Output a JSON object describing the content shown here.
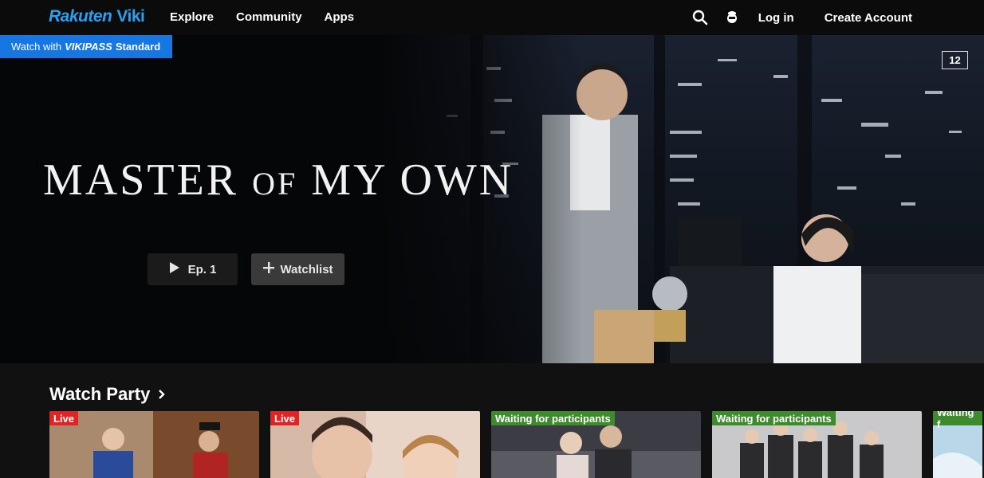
{
  "nav": {
    "logo_rakuten": "Rakuten",
    "logo_viki": "Viki",
    "links": [
      "Explore",
      "Community",
      "Apps"
    ],
    "login": "Log in",
    "create_account": "Create Account"
  },
  "hero": {
    "pass_prefix": "Watch with",
    "pass_brand": "VIKIPASS",
    "pass_tier": "Standard",
    "rating": "12",
    "title_part1": "MASTER",
    "title_of": "OF",
    "title_part2": "MY OWN",
    "play_label": "Ep. 1",
    "watchlist_label": "Watchlist"
  },
  "watch_party": {
    "title": "Watch Party",
    "cards": [
      {
        "tag": "Live",
        "tag_type": "live"
      },
      {
        "tag": "Live",
        "tag_type": "live"
      },
      {
        "tag": "Waiting for participants",
        "tag_type": "waiting"
      },
      {
        "tag": "Waiting for participants",
        "tag_type": "waiting"
      },
      {
        "tag": "Waiting f",
        "tag_type": "waiting"
      }
    ]
  },
  "colors": {
    "brand_blue": "#2b9ff0",
    "pass_blue": "#1677e2",
    "live_red": "#e02424",
    "waiting_green": "#3e8b2e"
  },
  "icons": [
    "search-icon",
    "user-avatar-icon",
    "play-icon",
    "plus-icon",
    "chevron-right-icon"
  ]
}
